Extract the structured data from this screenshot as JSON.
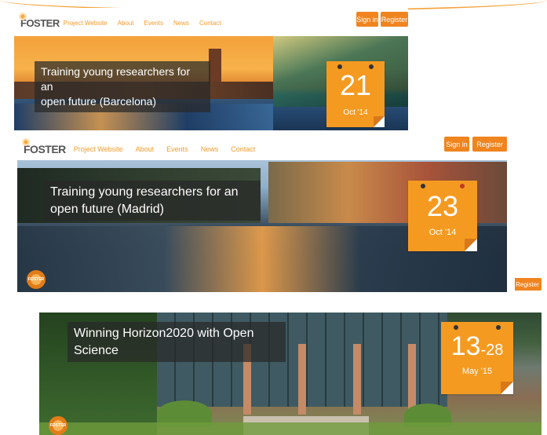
{
  "nav": {
    "logo": "FOSTER",
    "links": [
      "Project Website",
      "About",
      "Events",
      "News",
      "Contact"
    ],
    "signin": "Sign in",
    "register": "Register"
  },
  "cards": [
    {
      "caption_line1": "Training young researchers for an",
      "caption_line2": "open future (Barcelona)",
      "day": "21",
      "month": "Oct '14"
    },
    {
      "caption_line1": "Training young researchers for an",
      "caption_line2": "open future (Madrid)",
      "day": "23",
      "month": "Oct '14"
    },
    {
      "caption_line1": "Winning Horizon2020 with Open",
      "caption_line2": "Science",
      "day": "13",
      "day_range": "-28",
      "month": "May '15"
    }
  ],
  "badge_text": "FOSTER",
  "colors": {
    "accent": "#f0841f",
    "date_tile": "#f59a21",
    "link": "#f39b2f"
  }
}
